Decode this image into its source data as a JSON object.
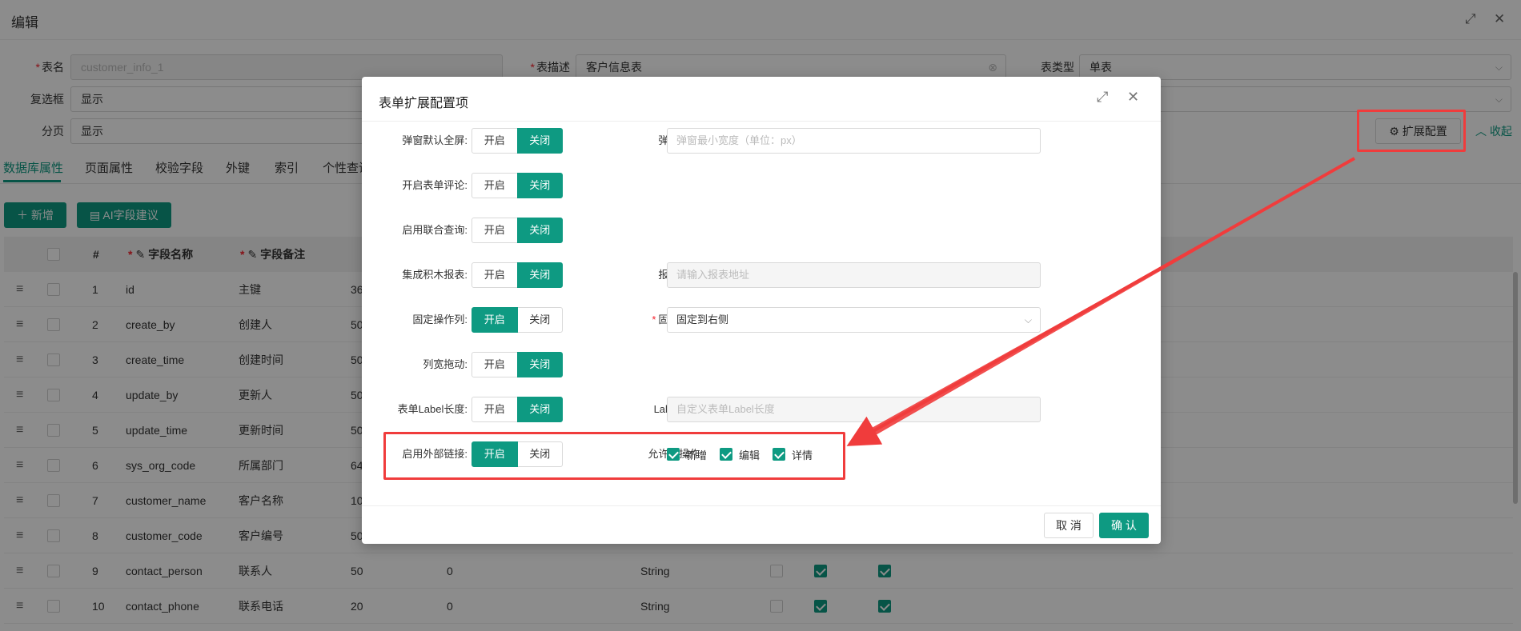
{
  "header": {
    "title": "编辑",
    "expand_icon": "expand-icon",
    "close_icon": "close-icon"
  },
  "form": {
    "table_name_label": "表名",
    "table_name_value": "customer_info_1",
    "table_desc_label": "表描述",
    "table_desc_value": "客户信息表",
    "table_type_label": "表类型",
    "table_type_value": "单表",
    "checkbox_label": "复选框",
    "checkbox_value": "显示",
    "paging_label": "分页",
    "paging_value": "显示"
  },
  "toolbar": {
    "extend_config_label": "扩展配置",
    "collapse_label": "收起",
    "add_label": "新增",
    "ai_label": "AI字段建议"
  },
  "tabs": [
    "数据库属性",
    "页面属性",
    "校验字段",
    "外键",
    "索引",
    "个性查询"
  ],
  "table": {
    "columns": {
      "index": "#",
      "field_name": "字段名称",
      "field_comment": "字段备注"
    },
    "rows": [
      {
        "no": "1",
        "name": "id",
        "comment": "主键",
        "len": "36"
      },
      {
        "no": "2",
        "name": "create_by",
        "comment": "创建人",
        "len": "50"
      },
      {
        "no": "3",
        "name": "create_time",
        "comment": "创建时间",
        "len": "50"
      },
      {
        "no": "4",
        "name": "update_by",
        "comment": "更新人",
        "len": "50"
      },
      {
        "no": "5",
        "name": "update_time",
        "comment": "更新时间",
        "len": "50"
      },
      {
        "no": "6",
        "name": "sys_org_code",
        "comment": "所属部门",
        "len": "64"
      },
      {
        "no": "7",
        "name": "customer_name",
        "comment": "客户名称",
        "len": "10"
      },
      {
        "no": "8",
        "name": "customer_code",
        "comment": "客户编号",
        "len": "50"
      },
      {
        "no": "9",
        "name": "contact_person",
        "comment": "联系人",
        "len": "50",
        "point": "0",
        "type": "String"
      },
      {
        "no": "10",
        "name": "contact_phone",
        "comment": "联系电话",
        "len": "20",
        "point": "0",
        "type": "String"
      }
    ]
  },
  "modal": {
    "title": "表单扩展配置项",
    "on_label": "开启",
    "off_label": "关闭",
    "popup_fullscreen": "弹窗默认全屏:",
    "popup_width": "弹窗宽度:",
    "popup_width_placeholder": "弹窗最小宽度（单位：px）",
    "form_comment": "开启表单评论:",
    "joint_query": "启用联合查询:",
    "jimu_report": "集成积木报表:",
    "report_url": "报表地址:",
    "report_url_placeholder": "请输入报表地址",
    "fixed_column": "固定操作列:",
    "fixed_mode": "固定方式:",
    "fixed_mode_value": "固定到右侧",
    "col_drag": "列宽拖动:",
    "label_length": "表单Label长度:",
    "label_len": "Label长度:",
    "label_len_placeholder": "自定义表单Label长度",
    "external_link": "启用外部链接:",
    "allowed_ops": "允许的操作:",
    "op_add": "新增",
    "op_edit": "编辑",
    "op_detail": "详情",
    "cancel": "取 消",
    "confirm": "确 认"
  },
  "colors": {
    "accent": "#0e9a82",
    "annotation": "#f03c3c"
  }
}
